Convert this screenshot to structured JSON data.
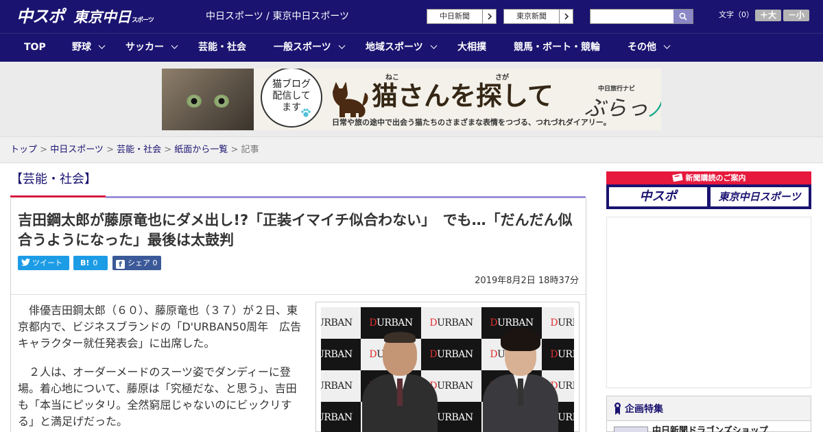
{
  "header": {
    "logo_main": "中スポ",
    "logo_sub": "東京中日",
    "logo_sub_small": "スポーツ",
    "site_names": "中日スポーツ / 東京中日スポーツ",
    "paper_links": [
      "中日新聞",
      "東京新聞"
    ],
    "search_placeholder": "",
    "font_size_label": "文字（0）",
    "font_up": "＋大",
    "font_down": "－小"
  },
  "nav": {
    "items": [
      "TOP",
      "野球",
      "サッカー",
      "芸能・社会",
      "一般スポーツ",
      "地域スポーツ",
      "大相撲",
      "競馬・ボート・競輪",
      "その他"
    ]
  },
  "banner": {
    "bubble_text": "猫ブログ\n配信して\nます",
    "title": "猫さんを探して",
    "ruby_1": "ねこ",
    "ruby_2": "さが",
    "subtitle": "日常や旅の途中で出会う猫たちのさまざまな表情をつづる、つれづれダイアリー。",
    "navi_label": "中日旅行ナビ",
    "navi_logo_a": "ぶらっ",
    "navi_logo_b": "人"
  },
  "breadcrumb": [
    "トップ",
    "中日スポーツ",
    "芸能・社会",
    "紙面から一覧",
    "記事"
  ],
  "section_title": "【芸能・社会】",
  "article": {
    "title": "吉田鋼太郎が藤原竜也にダメ出し!?「正装イマイチ似合わない」　でも…「だんだん似合うようになった」最後は太鼓判",
    "tweet_label": "ツイート",
    "hatena_label": "B!",
    "hatena_count": "0",
    "facebook_label": "シェア",
    "facebook_count": "0",
    "date": "2019年8月2日 18時37分",
    "paragraphs": [
      "俳優吉田鋼太郎（６０）、藤原竜也（３７）が２日、東京都内で、ビジネスブランドの「D'URBAN50周年　広告キャラクター就任発表会」に出席した。",
      "２人は、オーダーメードのスーツ姿でダンディーに登場。着心地について、藤原は「究極だな、と思う」、吉田も「本当にピッタリ。全然窮屈じゃないのにビックリする」と満足げだった。"
    ],
    "photo_text": "D'URBAN"
  },
  "sidebar": {
    "subscription_header": "新聞購読のご案内",
    "subscription_buttons": [
      "中スポ",
      "東京中日スポーツ"
    ],
    "kikaku_title": "企画特集",
    "kikaku_first_item": "中日新聞ドラゴンズショップ"
  },
  "colors": {
    "brand_navy": "#1a1370",
    "accent_red": "#e6183d",
    "twitter_blue": "#1d9ce6",
    "facebook_blue": "#3b5998"
  }
}
